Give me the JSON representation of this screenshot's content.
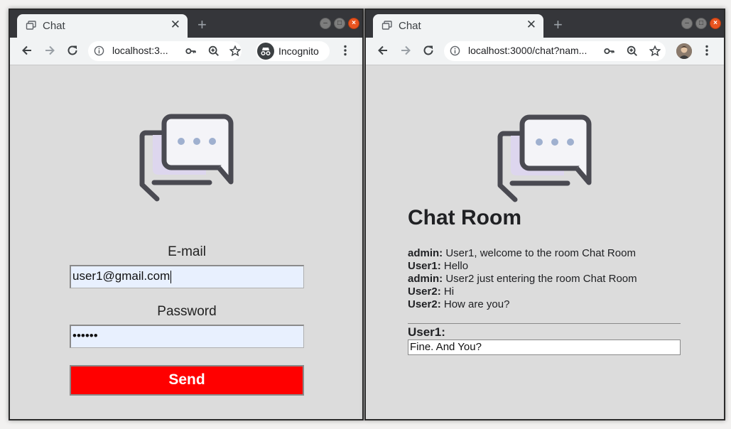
{
  "left_window": {
    "tab": {
      "title": "Chat"
    },
    "omnibox": {
      "url": "localhost:3..."
    },
    "profile": {
      "label": "Incognito"
    },
    "form": {
      "email_label": "E-mail",
      "email_value": "user1@gmail.com",
      "password_label": "Password",
      "password_value": "••••••",
      "send_label": "Send"
    }
  },
  "right_window": {
    "tab": {
      "title": "Chat"
    },
    "omnibox": {
      "url": "localhost:3000/chat?nam..."
    },
    "room": {
      "title": "Chat Room",
      "messages": [
        {
          "user": "admin:",
          "text": "User1, welcome to the room Chat Room"
        },
        {
          "user": "User1:",
          "text": "Hello"
        },
        {
          "user": "admin:",
          "text": "User2 just entering the room Chat Room"
        },
        {
          "user": "User2:",
          "text": "Hi"
        },
        {
          "user": "User2:",
          "text": "How are you?"
        }
      ],
      "current_user": "User1:",
      "message_input_value": "Fine. And You?"
    }
  },
  "colors": {
    "send_button": "#ff0000",
    "page_background": "#dcdcdc",
    "titlebar": "#35363a",
    "logo_stroke": "#4a4a52",
    "logo_fill": "#ddd6ee",
    "logo_dots": "#9fb0cf"
  },
  "icons": [
    "tab-favicon-icon",
    "close-tab-icon",
    "new-tab-icon",
    "back-icon",
    "forward-icon",
    "reload-icon",
    "info-icon",
    "key-icon",
    "zoom-icon",
    "star-icon",
    "incognito-icon",
    "menu-icon",
    "chat-bubbles-icon"
  ]
}
